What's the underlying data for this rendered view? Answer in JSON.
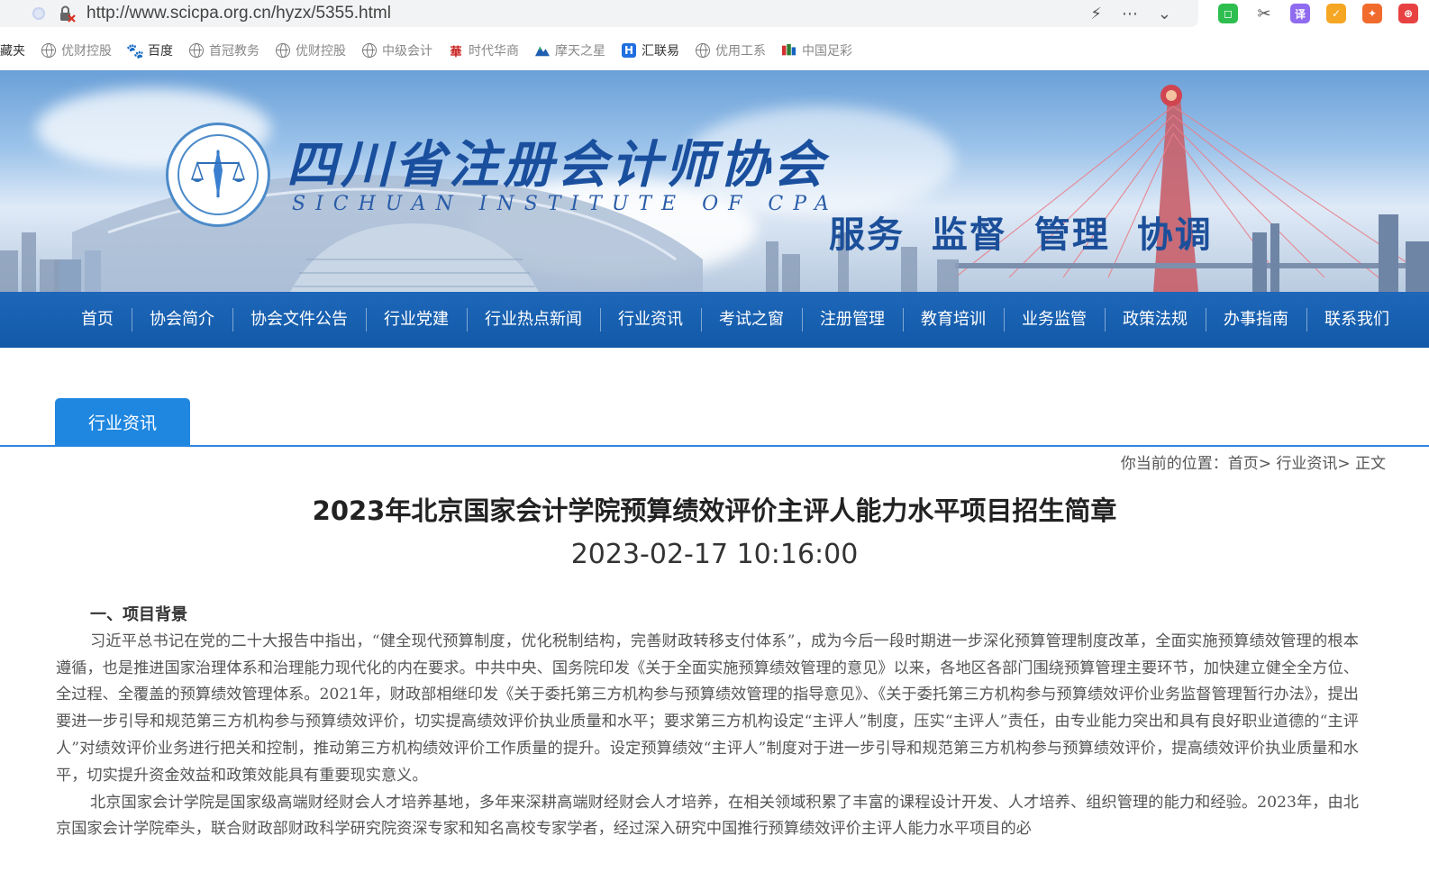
{
  "browser": {
    "url": "http://www.scicpa.org.cn/hyzx/5355.html",
    "tools": [
      "⚡",
      "⋯",
      "⌄"
    ],
    "extensions": [
      {
        "name": "wechat-ext-icon",
        "color": "#2dbe4f",
        "glyph": "◻"
      },
      {
        "name": "scissors-ext-icon",
        "color": "#ffffff",
        "glyph": "✂"
      },
      {
        "name": "translate-ext-icon",
        "color": "#8f6bf0",
        "glyph": "译"
      },
      {
        "name": "shield-ext-icon",
        "color": "#f5a623",
        "glyph": "✓"
      },
      {
        "name": "game-ext-icon",
        "color": "#f06b2c",
        "glyph": "✦"
      },
      {
        "name": "red-ext-icon",
        "color": "#e84141",
        "glyph": "⊕"
      }
    ]
  },
  "bookmarks": [
    {
      "label": "收藏夹",
      "icon": "none"
    },
    {
      "label": "优财控股",
      "icon": "globe"
    },
    {
      "label": "百度",
      "icon": "baidu-paw"
    },
    {
      "label": "首冠教务",
      "icon": "globe"
    },
    {
      "label": "优财控股",
      "icon": "globe"
    },
    {
      "label": "中级会计",
      "icon": "globe"
    },
    {
      "label": "时代华商",
      "icon": "hua"
    },
    {
      "label": "摩天之星",
      "icon": "mountain"
    },
    {
      "label": "汇联易",
      "icon": "hui"
    },
    {
      "label": "优用工系",
      "icon": "globe"
    },
    {
      "label": "中国足彩",
      "icon": "zucai"
    }
  ],
  "banner": {
    "title_cn": "四川省注册会计师协会",
    "title_en": "SICHUAN INSTITUTE OF CPA",
    "slogan": "服务 监督 管理 协调"
  },
  "nav": [
    "首页",
    "协会简介",
    "协会文件公告",
    "行业党建",
    "行业热点新闻",
    "行业资讯",
    "考试之窗",
    "注册管理",
    "教育培训",
    "业务监管",
    "政策法规",
    "办事指南",
    "联系我们"
  ],
  "tab": {
    "label": "行业资讯"
  },
  "breadcrumb": "你当前的位置：首页> 行业资讯> 正文",
  "article": {
    "title": "2023年北京国家会计学院预算绩效评价主评人能力水平项目招生简章",
    "date": "2023-02-17 10:16:00",
    "section1": "一、项目背景",
    "para1": "习近平总书记在党的二十大报告中指出，“健全现代预算制度，优化税制结构，完善财政转移支付体系”，成为今后一段时期进一步深化预算管理制度改革，全面实施预算绩效管理的根本遵循，也是推进国家治理体系和治理能力现代化的内在要求。中共中央、国务院印发《关于全面实施预算绩效管理的意见》以来，各地区各部门围绕预算管理主要环节，加快建立健全全方位、全过程、全覆盖的预算绩效管理体系。2021年，财政部相继印发《关于委托第三方机构参与预算绩效管理的指导意见》、《关于委托第三方机构参与预算绩效评价业务监督管理暂行办法》，提出要进一步引导和规范第三方机构参与预算绩效评价，切实提高绩效评价执业质量和水平；要求第三方机构设定“主评人”制度，压实“主评人”责任，由专业能力突出和具有良好职业道德的“主评人”对绩效评价业务进行把关和控制，推动第三方机构绩效评价工作质量的提升。设定预算绩效“主评人”制度对于进一步引导和规范第三方机构参与预算绩效评价，提高绩效评价执业质量和水平，切实提升资金效益和政策效能具有重要现实意义。",
    "para2": "北京国家会计学院是国家级高端财经财会人才培养基地，多年来深耕高端财经财会人才培养，在相关领域积累了丰富的课程设计开发、人才培养、组织管理的能力和经验。2023年，由北京国家会计学院牵头，联合财政部财政科学研究院资深专家和知名高校专家学者，经过深入研究中国推行预算绩效评价主评人能力水平项目的必"
  }
}
